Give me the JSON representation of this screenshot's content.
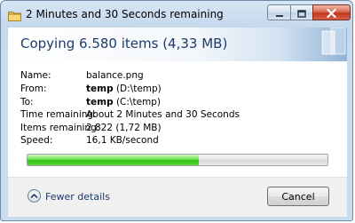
{
  "window": {
    "title": "2 Minutes and 30 Seconds remaining",
    "title_icon": "folder-icon"
  },
  "caption_buttons": {
    "minimize_icon": "minimize-icon",
    "maximize_icon": "maximize-icon",
    "close_icon": "close-icon"
  },
  "header": {
    "title": "Copying 6.580 items (4,33 MB)"
  },
  "details": [
    {
      "label": "Name:",
      "value_bold": "",
      "value": "balance.png"
    },
    {
      "label": "From:",
      "value_bold": "temp",
      "value": " (D:\\temp)"
    },
    {
      "label": "To:",
      "value_bold": "temp",
      "value": " (C:\\temp)"
    },
    {
      "label": "Time remaining:",
      "value_bold": "",
      "value": "About 2 Minutes and 30 Seconds"
    },
    {
      "label": "Items remaining:",
      "value_bold": "",
      "value": "2.822 (1,72 MB)"
    },
    {
      "label": "Speed:",
      "value_bold": "",
      "value": "16,1 KB/second"
    }
  ],
  "progress": {
    "fraction": 0.57,
    "color": "#2fbf1b"
  },
  "footer": {
    "fewer_details_label": "Fewer details",
    "fewer_details_icon": "chevron-up-icon",
    "cancel_label": "Cancel"
  }
}
